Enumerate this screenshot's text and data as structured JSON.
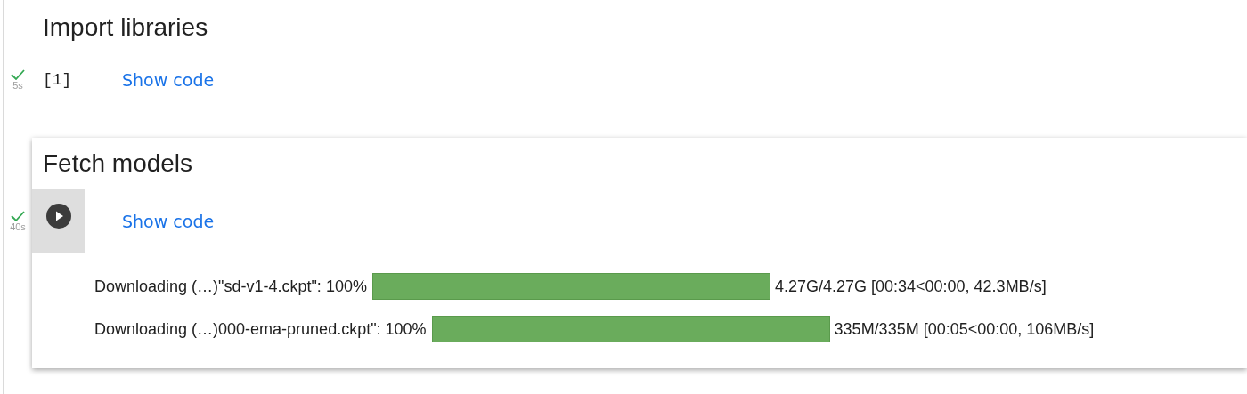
{
  "cells": [
    {
      "title": "Import libraries",
      "focused": false,
      "status": {
        "done": true,
        "time": "5s"
      },
      "prompt": {
        "kind": "count",
        "text": "[1]"
      },
      "show_code": "Show code"
    },
    {
      "title": "Fetch models",
      "focused": true,
      "status": {
        "done": true,
        "time": "40s"
      },
      "prompt": {
        "kind": "run"
      },
      "show_code": "Show code",
      "outputs": [
        {
          "label": "Downloading (…)\"sd-v1-4.ckpt\": 100%",
          "level": 1,
          "stats": "4.27G/4.27G [00:34<00:00, 42.3MB/s]"
        },
        {
          "label": "Downloading (…)000-ema-pruned.ckpt\": 100%",
          "level": 1,
          "stats": "335M/335M [00:05<00:00, 106MB/s]"
        }
      ]
    }
  ]
}
